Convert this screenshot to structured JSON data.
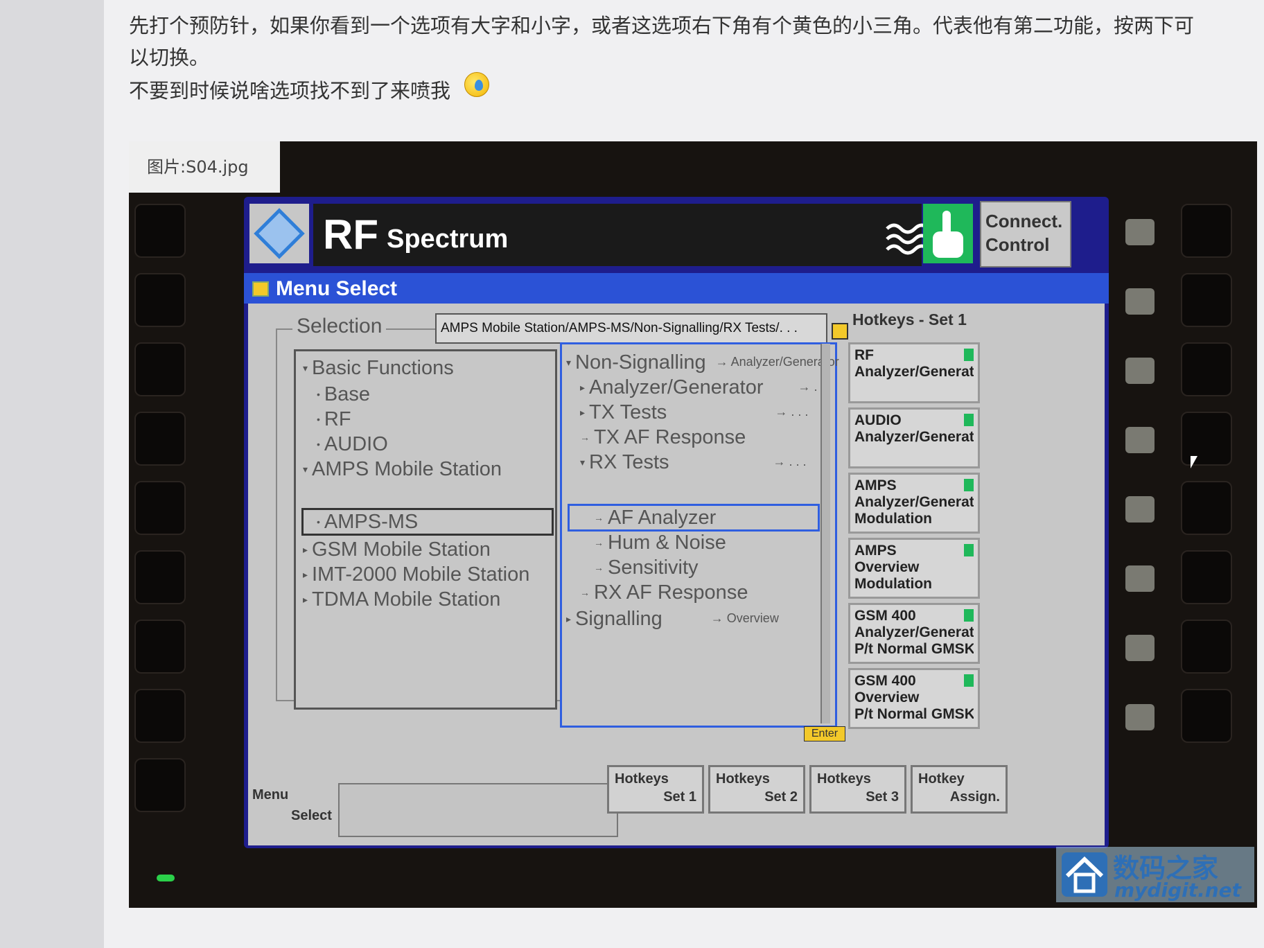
{
  "post": {
    "line1": "先打个预防针，如果你看到一个选项有大字和小字，或者这选项右下角有个黄色的小三角。代表他有第二功能，按两下可",
    "line2": "以切换。",
    "line3": "不要到时候说啥选项找不到了来喷我"
  },
  "image_caption": "图片:S04.jpg",
  "device": {
    "title_main": "RF",
    "title_sub": "Spectrum",
    "connect_control": [
      "Connect.",
      "Control"
    ],
    "menu_title": "Menu Select",
    "selection_label": "Selection",
    "path": "AMPS Mobile Station/AMPS-MS/Non-Signalling/RX Tests/. . .",
    "left_tree": [
      {
        "label": "Basic Functions",
        "marker": "▾"
      },
      {
        "label": "Base",
        "marker": "•"
      },
      {
        "label": "RF",
        "marker": "•"
      },
      {
        "label": "AUDIO",
        "marker": "•"
      },
      {
        "label": "AMPS Mobile Station",
        "marker": "▾"
      },
      {
        "label": "AMPS-MS",
        "marker": "•"
      },
      {
        "label": "GSM Mobile Station",
        "marker": "▸"
      },
      {
        "label": "IMT-2000 Mobile Station",
        "marker": "▸"
      },
      {
        "label": "TDMA Mobile Station",
        "marker": "▸"
      }
    ],
    "right_tree": [
      {
        "label": "Non-Signalling",
        "marker": "▾",
        "sub": "→ Analyzer/Generator"
      },
      {
        "label": "Analyzer/Generator",
        "marker": "▸",
        "sub": "→ . . ."
      },
      {
        "label": "TX Tests",
        "marker": "▸",
        "sub": "→ . . ."
      },
      {
        "label": "TX AF Response",
        "marker": "→",
        "sub": ""
      },
      {
        "label": "RX Tests",
        "marker": "▾",
        "sub": "→ . . ."
      },
      {
        "label": "AF Analyzer",
        "marker": "→",
        "sub": ""
      },
      {
        "label": "Hum & Noise",
        "marker": "→",
        "sub": ""
      },
      {
        "label": "Sensitivity",
        "marker": "→",
        "sub": ""
      },
      {
        "label": "RX AF Response",
        "marker": "→",
        "sub": ""
      },
      {
        "label": "Signalling",
        "marker": "▸",
        "sub": "→ Overview"
      }
    ],
    "enter_label": "Enter",
    "hotkeys_title": "Hotkeys - Set 1",
    "hotkeys": [
      {
        "lines": [
          "RF",
          "Analyzer/Generator"
        ]
      },
      {
        "lines": [
          "AUDIO",
          "Analyzer/Generator"
        ]
      },
      {
        "lines": [
          "AMPS",
          "Analyzer/Generator",
          "Modulation"
        ]
      },
      {
        "lines": [
          "AMPS",
          "Overview",
          "Modulation"
        ]
      },
      {
        "lines": [
          "GSM 400",
          "Analyzer/Generator",
          "P/t Normal GMSK"
        ]
      },
      {
        "lines": [
          "GSM 400",
          "Overview",
          "P/t Normal GMSK"
        ]
      }
    ],
    "menu_select_label": [
      "Menu",
      "Select"
    ],
    "softkeys": [
      {
        "top": "Hotkeys",
        "bottom": "Set 1"
      },
      {
        "top": "Hotkeys",
        "bottom": "Set 2"
      },
      {
        "top": "Hotkeys",
        "bottom": "Set 3"
      },
      {
        "top": "Hotkey",
        "bottom": "Assign."
      }
    ]
  },
  "watermark": {
    "cn": "数码之家",
    "en": "mydigit.net"
  },
  "colors": {
    "menu_bar": "#2b52d6",
    "highlight": "#2f5ee0",
    "accent_yellow": "#f3c92a",
    "status_green": "#1fb85a"
  }
}
